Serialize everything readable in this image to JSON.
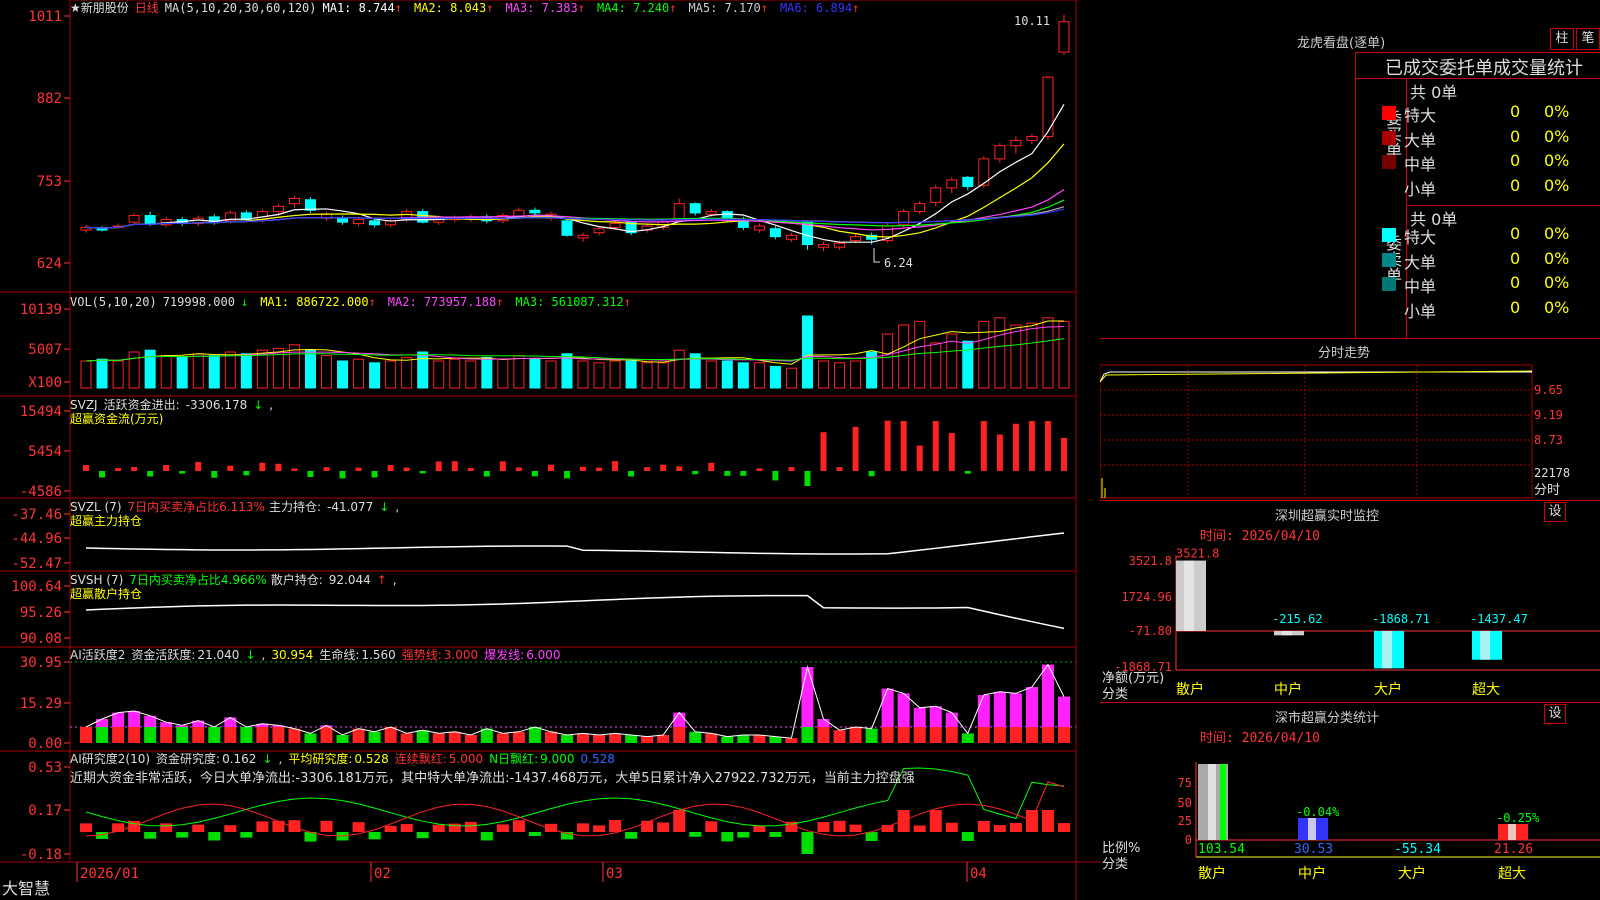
{
  "stock": {
    "name": "★新朋股份",
    "period": "日线",
    "ma_header": "MA(5,10,20,30,60,120)",
    "ma_items": [
      {
        "label": "MA1:",
        "value": "8.744",
        "arrow": "↑",
        "color": "#ffffff"
      },
      {
        "label": "MA2:",
        "value": "8.043",
        "arrow": "↑",
        "color": "#ffff00"
      },
      {
        "label": "MA3:",
        "value": "7.383",
        "arrow": "↑",
        "color": "#ff44ff"
      },
      {
        "label": "MA4:",
        "value": "7.240",
        "arrow": "↑",
        "color": "#00ff00"
      },
      {
        "label": "MA5:",
        "value": "7.170",
        "arrow": "↑",
        "color": "#cccccc"
      },
      {
        "label": "MA6:",
        "value": "6.894",
        "arrow": "↑",
        "color": "#3333ff"
      }
    ],
    "high_mark": "10.11",
    "low_mark": "6.24"
  },
  "colors": {
    "up": "#ff2222",
    "down": "#00ffff",
    "grid": "#aa0000",
    "axis": "#ff3333",
    "ma1": "#ffffff",
    "ma2": "#ffff00",
    "ma3": "#ff44ff",
    "ma4": "#00ff00",
    "ma5": "#aaaaaa",
    "ma6": "#3333ff"
  },
  "chart_data": [
    {
      "type": "candlestick",
      "yticks": [
        "1011",
        "882",
        "753",
        "624"
      ],
      "ylim": [
        590,
        1030
      ],
      "x_labels": [
        "2026/01",
        "02",
        "03",
        "04"
      ],
      "candles": [
        [
          684,
          688,
          680,
          692,
          0
        ],
        [
          684,
          686,
          682,
          690,
          1
        ],
        [
          688,
          690,
          686,
          694,
          0
        ],
        [
          696,
          706,
          694,
          710,
          0
        ],
        [
          706,
          694,
          690,
          712,
          1
        ],
        [
          692,
          700,
          688,
          704,
          0
        ],
        [
          700,
          694,
          690,
          704,
          1
        ],
        [
          694,
          702,
          690,
          706,
          0
        ],
        [
          704,
          696,
          692,
          708,
          1
        ],
        [
          698,
          710,
          694,
          714,
          0
        ],
        [
          710,
          700,
          696,
          714,
          1
        ],
        [
          700,
          712,
          696,
          716,
          0
        ],
        [
          712,
          720,
          706,
          724,
          0
        ],
        [
          724,
          732,
          718,
          736,
          0
        ],
        [
          730,
          714,
          710,
          734,
          1
        ],
        [
          708,
          702,
          698,
          712,
          0
        ],
        [
          702,
          696,
          692,
          706,
          1
        ],
        [
          694,
          700,
          690,
          704,
          0
        ],
        [
          698,
          692,
          688,
          702,
          1
        ],
        [
          692,
          698,
          688,
          702,
          0
        ],
        [
          700,
          712,
          696,
          716,
          0
        ],
        [
          712,
          696,
          694,
          716,
          1
        ],
        [
          696,
          702,
          692,
          706,
          0
        ],
        [
          702,
          700,
          696,
          706,
          0
        ],
        [
          700,
          704,
          696,
          708,
          0
        ],
        [
          704,
          698,
          694,
          708,
          1
        ],
        [
          698,
          706,
          694,
          710,
          0
        ],
        [
          704,
          714,
          700,
          718,
          0
        ],
        [
          714,
          710,
          706,
          718,
          1
        ],
        [
          708,
          702,
          698,
          712,
          0
        ],
        [
          698,
          676,
          674,
          700,
          1
        ],
        [
          676,
          672,
          666,
          680,
          0
        ],
        [
          680,
          686,
          676,
          690,
          0
        ],
        [
          688,
          694,
          684,
          698,
          0
        ],
        [
          696,
          680,
          676,
          698,
          1
        ],
        [
          684,
          690,
          680,
          694,
          0
        ],
        [
          688,
          696,
          684,
          700,
          0
        ],
        [
          700,
          724,
          696,
          732,
          0
        ],
        [
          724,
          710,
          706,
          726,
          1
        ],
        [
          708,
          712,
          704,
          716,
          0
        ],
        [
          712,
          700,
          696,
          714,
          1
        ],
        [
          698,
          688,
          684,
          704,
          1
        ],
        [
          690,
          684,
          680,
          694,
          0
        ],
        [
          686,
          674,
          670,
          690,
          1
        ],
        [
          676,
          670,
          666,
          680,
          0
        ],
        [
          696,
          662,
          654,
          698,
          1
        ],
        [
          662,
          658,
          652,
          666,
          0
        ],
        [
          658,
          664,
          654,
          668,
          0
        ],
        [
          668,
          674,
          664,
          678,
          0
        ],
        [
          676,
          670,
          662,
          680,
          1
        ],
        [
          668,
          690,
          664,
          694,
          0
        ],
        [
          692,
          712,
          688,
          716,
          0
        ],
        [
          712,
          724,
          708,
          728,
          0
        ],
        [
          726,
          748,
          720,
          752,
          0
        ],
        [
          748,
          760,
          740,
          764,
          0
        ],
        [
          764,
          750,
          744,
          766,
          1
        ],
        [
          752,
          792,
          748,
          796,
          0
        ],
        [
          792,
          812,
          786,
          816,
          0
        ],
        [
          812,
          820,
          800,
          826,
          0
        ],
        [
          820,
          826,
          814,
          830,
          0
        ],
        [
          826,
          916,
          820,
          918,
          0
        ],
        [
          954,
          1000,
          950,
          1011,
          0
        ]
      ],
      "note": "Each candle: [open, close, low, high, is_down] in price*100 units"
    }
  ],
  "panels": {
    "vol": {
      "header": "VOL(5,10,20)",
      "value": "719998.000",
      "ma": [
        {
          "t": "MA1:",
          "v": "886722.000",
          "c": "#ffff00"
        },
        {
          "t": "MA2:",
          "v": "773957.188",
          "c": "#ff44ff"
        },
        {
          "t": "MA3:",
          "v": "561087.312",
          "c": "#00ff00"
        }
      ],
      "yticks": [
        "10139",
        "5007",
        "X100"
      ]
    },
    "svzj": {
      "header": "SVZJ",
      "sub": "活跃资金进出:",
      "value": "-3306.178",
      "title": "超赢资金流(万元)",
      "yticks": [
        "15494",
        "5454",
        "-4586"
      ]
    },
    "svzl": {
      "header": "SVZL (7)",
      "desc": "7日内买卖净占比6.113%",
      "sub": "主力持仓:",
      "value": "-41.077",
      "title": "超赢主力持仓",
      "yticks": [
        "-37.46",
        "-44.96",
        "-52.47"
      ]
    },
    "svsh": {
      "header": "SVSH (7)",
      "desc": "7日内买卖净占比4.966%",
      "sub": "散户持仓:",
      "value": "92.044",
      "title": "超赢散户持仓",
      "yticks": [
        "100.64",
        "95.26",
        "90.08"
      ]
    },
    "ai2": {
      "header": "AI活跃度2",
      "sub": "资金活跃度:",
      "v1": "21.040",
      "v2": "30.954",
      "l1": "生命线:",
      "v3": "1.560",
      "l2": "强势线:",
      "v4": "3.000",
      "l3": "爆发线:",
      "v5": "6.000",
      "yticks": [
        "30.95",
        "15.29",
        "0.00"
      ]
    },
    "ai3": {
      "header": "AI研究度2(10)",
      "sub": "资金研究度:",
      "v1": "0.162",
      "l1": "平均研究度:",
      "v2": "0.528",
      "l2": "连续飘红:",
      "v3": "5.000",
      "l3": "N日飘红:",
      "v4": "9.000",
      "v5": "0.528",
      "msg": "近期大资金非常活跃，今日大单净流出:-3306.181万元，其中特大单净流出:-1437.468万元，大单5日累计净入27922.732万元，当前主力控盘强",
      "yticks": [
        "0.53",
        "0.17",
        "-0.18"
      ]
    }
  },
  "footer": {
    "brand": "大智慧",
    "months": [
      "2026/01",
      "02",
      "03",
      "04"
    ]
  },
  "right": {
    "dragon_title": "龙虎看盘(逐单)",
    "btn1": "柱",
    "btn2": "笔",
    "table_header": "已成交委托单成交量统计",
    "buy": {
      "label": "委买单",
      "total": "共 0单",
      "rows": [
        {
          "name": "特大",
          "n": "0",
          "pct": "0%",
          "c": "#ff0000"
        },
        {
          "name": "大单",
          "n": "0",
          "pct": "0%",
          "c": "#aa0000"
        },
        {
          "name": "中单",
          "n": "0",
          "pct": "0%",
          "c": "#770000"
        },
        {
          "name": "小单",
          "n": "0",
          "pct": "0%",
          "c": "#000000"
        }
      ]
    },
    "sell": {
      "label": "委卖单",
      "total": "共 0单",
      "rows": [
        {
          "name": "特大",
          "n": "0",
          "pct": "0%",
          "c": "#00ffff"
        },
        {
          "name": "大单",
          "n": "0",
          "pct": "0%",
          "c": "#008888"
        },
        {
          "name": "中单",
          "n": "0",
          "pct": "0%",
          "c": "#007777"
        },
        {
          "name": "小单",
          "n": "0",
          "pct": "0%",
          "c": "#000000"
        }
      ]
    },
    "fenshi": {
      "title": "分时走势",
      "y": [
        "9.65",
        "9.19",
        "8.73",
        "22178"
      ],
      "unit": "分时"
    },
    "sz1": {
      "title": "深圳超赢实时监控",
      "time": "时间: 2026/04/10",
      "set": "设",
      "yticks": [
        "3521.8",
        "1724.96",
        "-71.80",
        "-1868.71"
      ],
      "ylabel": "净额(万元)",
      "xlabel": "分类",
      "cats": [
        "散户",
        "中户",
        "大户",
        "超大"
      ],
      "values": [
        3521.8,
        -215.62,
        -1868.71,
        -1437.47
      ],
      "labels": [
        "3521.8",
        "-215.62",
        "-1868.71",
        "-1437.47"
      ]
    },
    "sz2": {
      "title": "深市超赢分类统计",
      "time": "时间: 2026/04/10",
      "set": "设",
      "yticks": [
        "75",
        "50",
        "25",
        "0"
      ],
      "ylabel": "比例%",
      "xlabel": "分类",
      "cats": [
        "散户",
        "中户",
        "大户",
        "超大"
      ],
      "values": [
        103.54,
        30.53,
        -55.34,
        21.26
      ],
      "labels": [
        "103.54",
        "30.53",
        "-55.34",
        "21.26"
      ],
      "pct": [
        "",
        "-0.04%",
        "",
        "-0.25%"
      ]
    }
  }
}
